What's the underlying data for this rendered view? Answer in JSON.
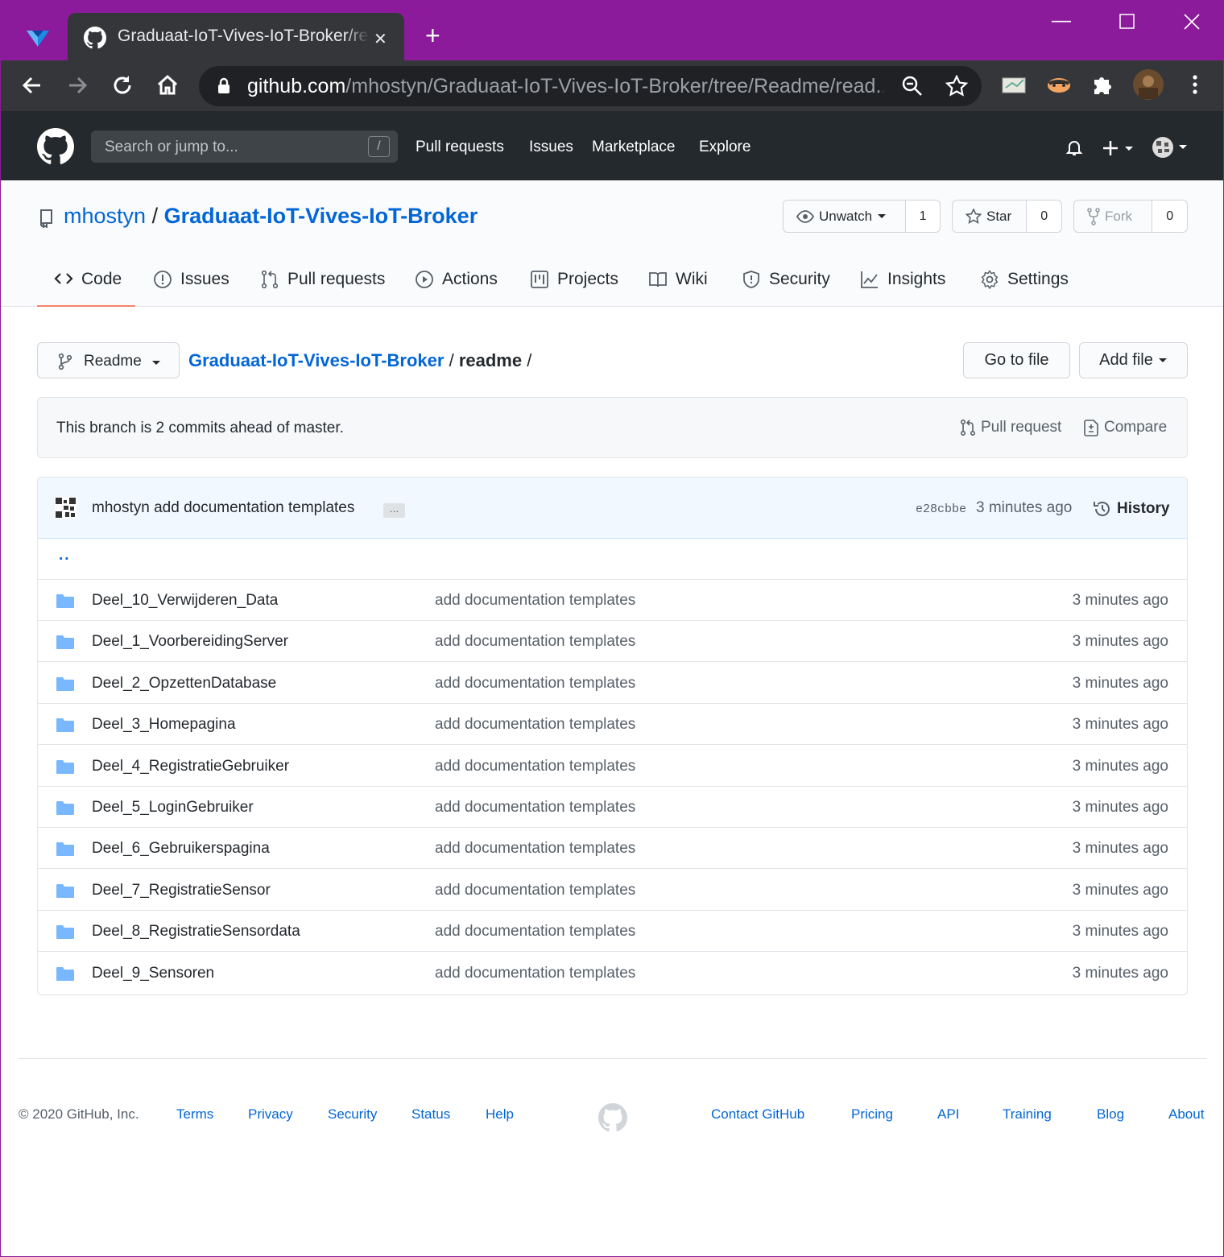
{
  "browser": {
    "tab_title": "Graduaat-IoT-Vives-IoT-Broker/re",
    "url_host": "github.com",
    "url_path": "/mhostyn/Graduaat-IoT-Vives-IoT-Broker/tree/Readme/read..."
  },
  "gh_header": {
    "search_placeholder": "Search or jump to...",
    "search_shortcut": "/",
    "nav": [
      "Pull requests",
      "Issues",
      "Marketplace",
      "Explore"
    ]
  },
  "repo": {
    "owner": "mhostyn",
    "separator": "/",
    "name": "Graduaat-IoT-Vives-IoT-Broker",
    "unwatch_label": "Unwatch",
    "watch_count": "1",
    "star_label": "Star",
    "star_count": "0",
    "fork_label": "Fork",
    "fork_count": "0",
    "tabs": [
      "Code",
      "Issues",
      "Pull requests",
      "Actions",
      "Projects",
      "Wiki",
      "Security",
      "Insights",
      "Settings"
    ]
  },
  "toolbar": {
    "branch": "Readme",
    "breadcrumb_root": "Graduaat-IoT-Vives-IoT-Broker",
    "breadcrumb_sep": "/",
    "breadcrumb_current": "readme",
    "breadcrumb_trailing": "/",
    "go_to_file": "Go to file",
    "add_file": "Add file"
  },
  "branch_status": {
    "text": "This branch is 2 commits ahead of master.",
    "pull_request": "Pull request",
    "compare": "Compare"
  },
  "latest_commit": {
    "message": "mhostyn add documentation templates",
    "ellipsis": "…",
    "sha": "e28cbbe",
    "time": "3 minutes ago",
    "history": "History"
  },
  "parent_dir": "..",
  "files": [
    {
      "name": "Deel_10_Verwijderen_Data",
      "message": "add documentation templates",
      "time": "3 minutes ago"
    },
    {
      "name": "Deel_1_VoorbereidingServer",
      "message": "add documentation templates",
      "time": "3 minutes ago"
    },
    {
      "name": "Deel_2_OpzettenDatabase",
      "message": "add documentation templates",
      "time": "3 minutes ago"
    },
    {
      "name": "Deel_3_Homepagina",
      "message": "add documentation templates",
      "time": "3 minutes ago"
    },
    {
      "name": "Deel_4_RegistratieGebruiker",
      "message": "add documentation templates",
      "time": "3 minutes ago"
    },
    {
      "name": "Deel_5_LoginGebruiker",
      "message": "add documentation templates",
      "time": "3 minutes ago"
    },
    {
      "name": "Deel_6_Gebruikerspagina",
      "message": "add documentation templates",
      "time": "3 minutes ago"
    },
    {
      "name": "Deel_7_RegistratieSensor",
      "message": "add documentation templates",
      "time": "3 minutes ago"
    },
    {
      "name": "Deel_8_RegistratieSensordata",
      "message": "add documentation templates",
      "time": "3 minutes ago"
    },
    {
      "name": "Deel_9_Sensoren",
      "message": "add documentation templates",
      "time": "3 minutes ago"
    }
  ],
  "footer": {
    "copyright": "© 2020 GitHub, Inc.",
    "links_left": [
      "Terms",
      "Privacy",
      "Security",
      "Status",
      "Help"
    ],
    "links_right": [
      "Contact GitHub",
      "Pricing",
      "API",
      "Training",
      "Blog",
      "About"
    ]
  },
  "colors": {
    "window_frame": "#8b1b9a",
    "link": "#0366d6",
    "header_bg": "#24292e",
    "folder": "#79b8ff",
    "selected_tab": "#f9826c"
  }
}
